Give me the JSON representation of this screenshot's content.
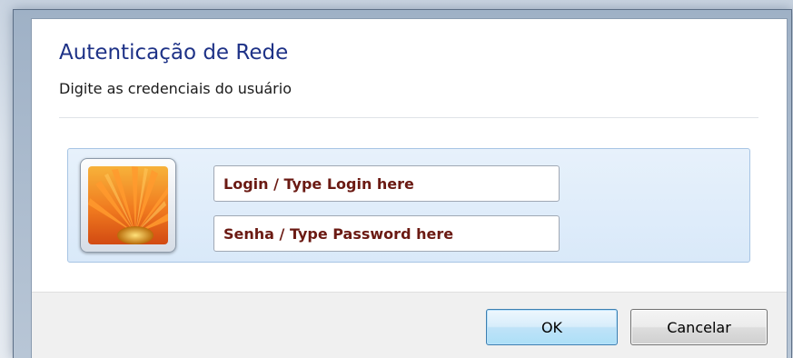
{
  "dialog": {
    "title": "Autenticação de Rede",
    "subtitle": "Digite as credenciais do usuário"
  },
  "credentials": {
    "avatar_icon": "user-tile-flower-icon",
    "login_placeholder": "Login / Type Login here",
    "password_placeholder": "Senha / Type Password here"
  },
  "buttons": {
    "ok_label": "OK",
    "cancel_label": "Cancelar"
  },
  "colors": {
    "title": "#1e3287",
    "field_text": "#6b1a13",
    "panel_background": "#dbe9f8",
    "ok_button_border": "#3c7fb1"
  }
}
